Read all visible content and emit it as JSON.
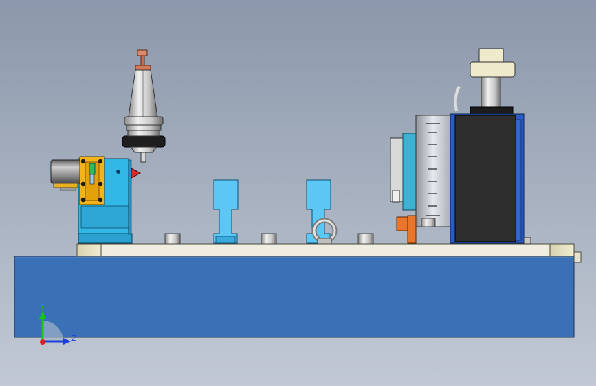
{
  "viewport": {
    "background_top": "#8b98ab",
    "background_bottom": "#c2c9d4"
  },
  "colors": {
    "base_blue": "#3a70b5",
    "fixture_cyan": "#31b8e6",
    "clamp_yellow": "#f2b419",
    "rail_cream": "#efeee0",
    "spindle_block_dark": "#2d2d2d",
    "bracket_blue": "#2a5cc8",
    "tool_silver": "#c9c9c9",
    "tip_copper": "#c9694b",
    "orange_block": "#e8762c"
  },
  "triad": {
    "y_label": "Y",
    "z_label": "Z",
    "y_color": "#19c419",
    "z_color": "#1e3fe0",
    "x_color": "#e02020"
  },
  "components": [
    "base-plate",
    "top-rail",
    "tool-holder",
    "left-fixture",
    "clamp-plate",
    "cylinder",
    "locator-pin-1",
    "locator-pin-2",
    "lifting-eye",
    "bolt-head",
    "rotary-table",
    "spindle-block",
    "spindle-head"
  ]
}
